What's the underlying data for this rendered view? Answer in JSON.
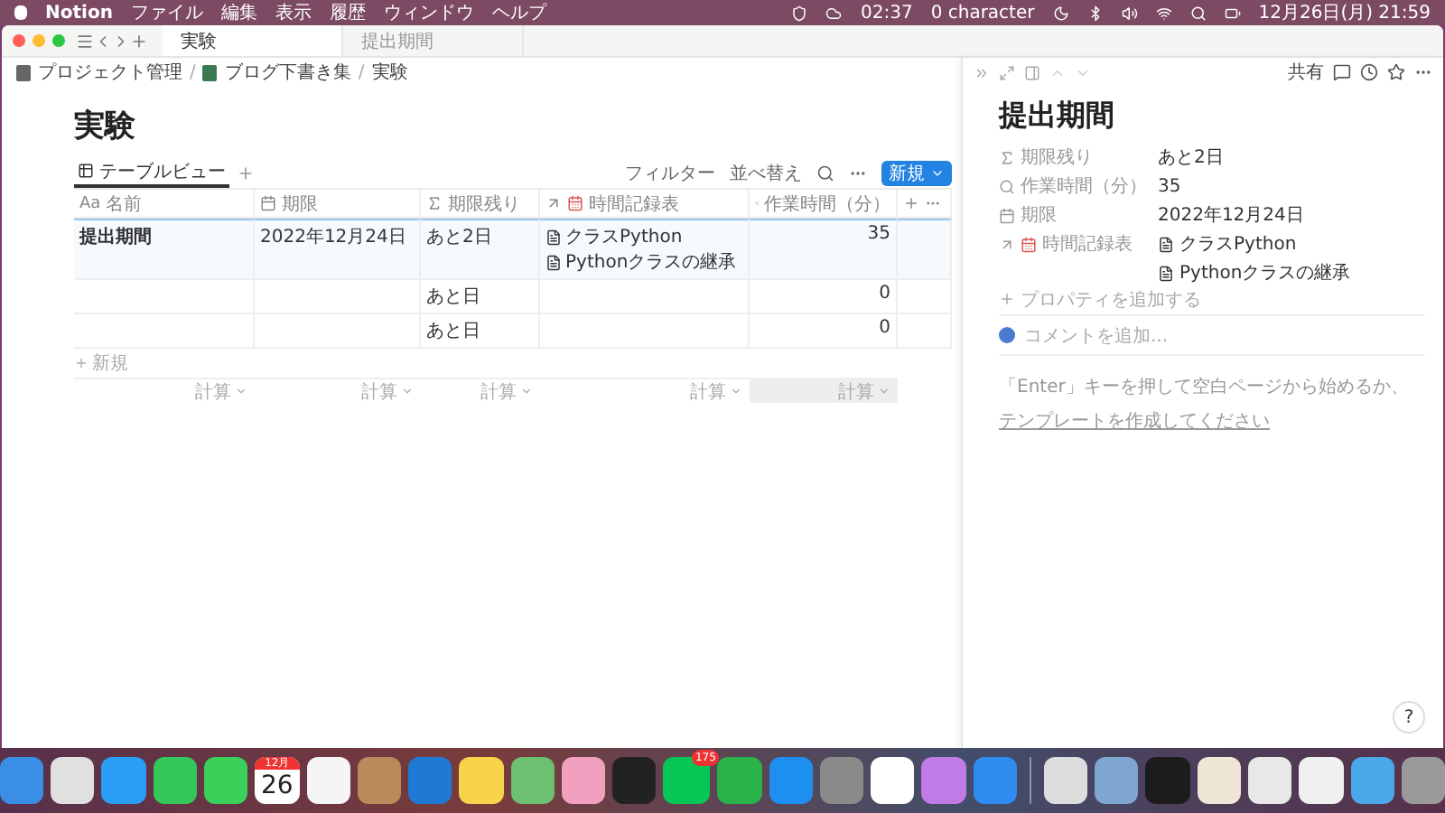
{
  "menubar": {
    "app": "Notion",
    "menus": [
      "ファイル",
      "編集",
      "表示",
      "履歴",
      "ウィンドウ",
      "ヘルプ"
    ],
    "timer": "02:37",
    "character": "0 character",
    "clock": "12月26日(月) 21:59"
  },
  "window": {
    "tabs": [
      {
        "label": "実験",
        "selected": true
      },
      {
        "label": "提出期間",
        "selected": false
      }
    ],
    "breadcrumbs": [
      "プロジェクト管理",
      "ブログ下書き集",
      "実験"
    ],
    "breadcrumb_separator": "/"
  },
  "page": {
    "title": "実験",
    "views": [
      {
        "label": "テーブルビュー",
        "selected": true
      }
    ],
    "filter": "フィルター",
    "sort": "並べ替え",
    "new_button": "新規",
    "table": {
      "columns": [
        {
          "kind": "title",
          "prefix": "Aa",
          "label": "名前"
        },
        {
          "kind": "date",
          "label": "期限"
        },
        {
          "kind": "formula",
          "label": "期限残り"
        },
        {
          "kind": "relation",
          "label": "時間記録表"
        },
        {
          "kind": "rollup",
          "label": "作業時間（分）"
        }
      ],
      "rows": [
        {
          "selected": true,
          "name": "提出期間",
          "date": "2022年12月24日",
          "remaining": "あと2日",
          "relations": [
            "クラスPython",
            "Pythonクラスの継承"
          ],
          "minutes": "35"
        },
        {
          "selected": false,
          "remaining": "あと日",
          "minutes": "0"
        },
        {
          "selected": false,
          "remaining": "あと日",
          "minutes": "0"
        }
      ],
      "add_row": "新規",
      "footer": [
        "計算",
        "計算",
        "計算",
        "計算",
        "計算"
      ]
    }
  },
  "side_peek": {
    "share": "共有",
    "title": "提出期間",
    "properties": [
      {
        "kind": "formula",
        "label": "期限残り",
        "values": [
          "あと2日"
        ]
      },
      {
        "kind": "rollup",
        "label": "作業時間（分）",
        "values": [
          "35"
        ]
      },
      {
        "kind": "date",
        "label": "期限",
        "values": [
          "2022年12月24日"
        ]
      },
      {
        "kind": "relation",
        "label": "時間記録表",
        "values": [
          "クラスPython",
          "Pythonクラスの継承"
        ]
      }
    ],
    "add_property": "プロパティを追加する",
    "comment_placeholder": "コメントを追加...",
    "hint": "「Enter」キーを押して空白ページから始めるか、",
    "template_link": "テンプレートを作成してください"
  },
  "help": "?",
  "dock": {
    "apps": [
      {
        "kind": "app",
        "color": "#3a8ee6"
      },
      {
        "kind": "app",
        "color": "#e0e0e0"
      },
      {
        "kind": "app",
        "color": "#2a9df4"
      },
      {
        "kind": "app",
        "color": "#34c759"
      },
      {
        "kind": "app",
        "color": "#3ad05a"
      },
      {
        "kind": "calendar",
        "month": "12月",
        "day": "26"
      },
      {
        "kind": "app",
        "color": "#f5f5f5"
      },
      {
        "kind": "app",
        "color": "#b98b5a"
      },
      {
        "kind": "app",
        "color": "#1f7ad6"
      },
      {
        "kind": "app",
        "color": "#f7d44a"
      },
      {
        "kind": "app",
        "color": "#6cc070"
      },
      {
        "kind": "app",
        "color": "#f2a0c0"
      },
      {
        "kind": "app",
        "color": "#222222"
      },
      {
        "kind": "line",
        "color": "#06c755",
        "badge": "175"
      },
      {
        "kind": "app",
        "color": "#29b34a"
      },
      {
        "kind": "app",
        "color": "#1d8ff0"
      },
      {
        "kind": "app",
        "color": "#8a8a8a"
      },
      {
        "kind": "app",
        "color": "#ffffff"
      },
      {
        "kind": "app",
        "color": "#c07be6"
      },
      {
        "kind": "app",
        "color": "#2f8cf0"
      }
    ],
    "others": [
      {
        "kind": "app",
        "color": "#dddddd"
      },
      {
        "kind": "app",
        "color": "#7fa6d0"
      },
      {
        "kind": "app",
        "color": "#1c1c1c"
      },
      {
        "kind": "app",
        "color": "#efe6d8"
      },
      {
        "kind": "app",
        "color": "#e8e8e8"
      },
      {
        "kind": "app",
        "color": "#f0f0f0"
      },
      {
        "kind": "app",
        "color": "#4aa8e8"
      },
      {
        "kind": "app",
        "color": "#9a9a9a"
      }
    ]
  }
}
